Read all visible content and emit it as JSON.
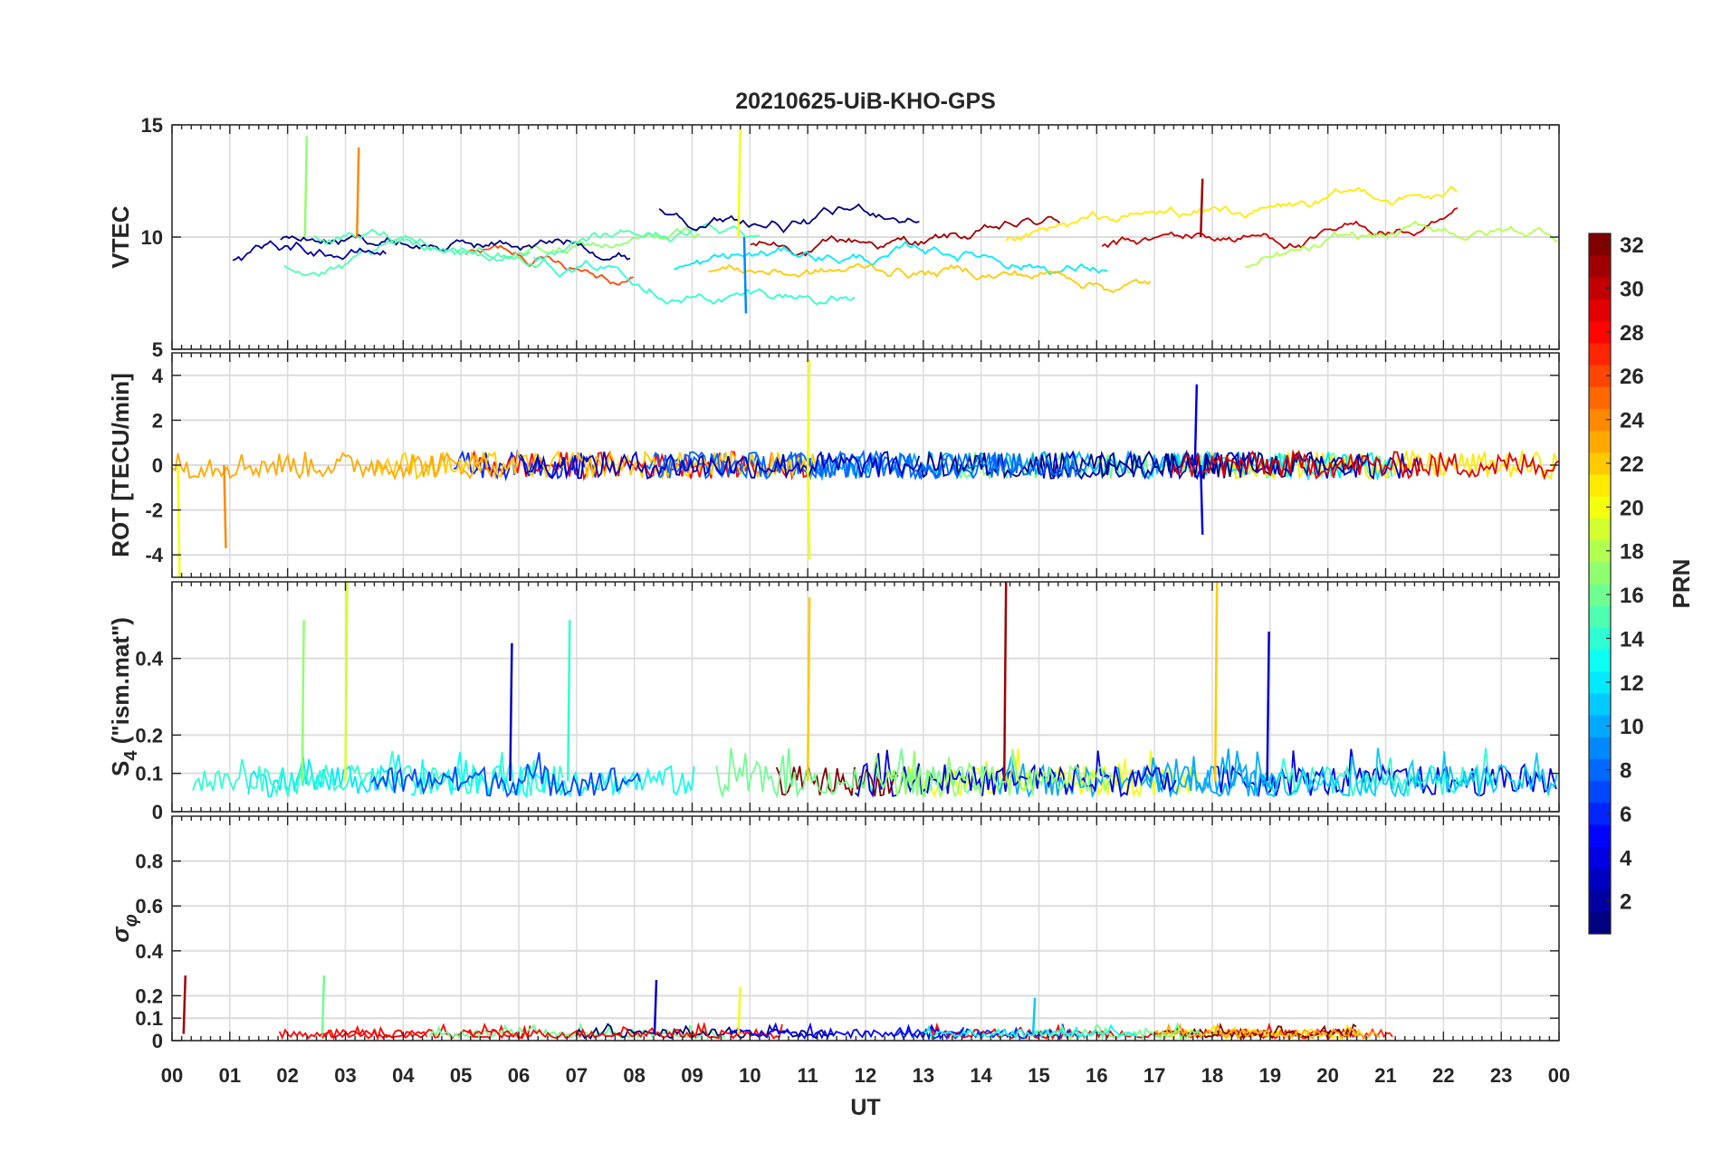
{
  "chart_data": {
    "type": "line",
    "title": "20210625-UiB-KHO-GPS",
    "xlabel": "UT",
    "x_ticks": [
      "00",
      "01",
      "02",
      "03",
      "04",
      "05",
      "06",
      "07",
      "08",
      "09",
      "10",
      "11",
      "12",
      "13",
      "14",
      "15",
      "16",
      "17",
      "18",
      "19",
      "20",
      "21",
      "22",
      "23",
      "00"
    ],
    "xlim": [
      0,
      24
    ],
    "grid": true,
    "colormap": "jet",
    "colorbar": {
      "label": "PRN",
      "range": [
        1,
        32
      ],
      "ticks": [
        "2",
        "4",
        "6",
        "8",
        "10",
        "12",
        "14",
        "16",
        "18",
        "20",
        "22",
        "24",
        "26",
        "28",
        "30",
        "32"
      ],
      "placement": "right"
    },
    "panels": [
      {
        "ylabel": "VTEC",
        "ylim": [
          5,
          15
        ],
        "yticks": [
          "5",
          "10",
          "15"
        ],
        "typical_range": [
          7,
          13
        ],
        "peak_events": [
          {
            "ut": 2.3,
            "value": 14.5,
            "prn": 17
          },
          {
            "ut": 3.2,
            "value": 14.0,
            "prn": 24
          },
          {
            "ut": 9.8,
            "value": 14.8,
            "prn": 20
          },
          {
            "ut": 9.9,
            "value": 6.6,
            "prn": 9
          },
          {
            "ut": 17.8,
            "value": 12.6,
            "prn": 31
          }
        ]
      },
      {
        "ylabel": "ROT [TECU/min]",
        "ylim": [
          -5,
          5
        ],
        "yticks": [
          "-4",
          "-2",
          "0",
          "2",
          "4"
        ],
        "typical_range": [
          -0.6,
          0.6
        ],
        "peak_events": [
          {
            "ut": 0.1,
            "value": -5.0,
            "prn": 20
          },
          {
            "ut": 0.9,
            "value": -3.7,
            "prn": 24
          },
          {
            "ut": 11.0,
            "value": 4.7,
            "prn": 20
          },
          {
            "ut": 11.0,
            "value": -4.2,
            "prn": 20
          },
          {
            "ut": 17.7,
            "value": 3.6,
            "prn": 4
          },
          {
            "ut": 17.8,
            "value": -3.1,
            "prn": 4
          }
        ]
      },
      {
        "ylabel": "S4 (\"ism.mat\")",
        "ylim": [
          0,
          0.6
        ],
        "yticks": [
          "0",
          "0.1",
          "0.2",
          "0.4"
        ],
        "typical_range": [
          0.04,
          0.12
        ],
        "peak_events": [
          {
            "ut": 2.25,
            "value": 0.5,
            "prn": 17
          },
          {
            "ut": 3.0,
            "value": 0.6,
            "prn": 19
          },
          {
            "ut": 5.85,
            "value": 0.44,
            "prn": 3
          },
          {
            "ut": 6.85,
            "value": 0.5,
            "prn": 14
          },
          {
            "ut": 11.0,
            "value": 0.56,
            "prn": 22
          },
          {
            "ut": 14.4,
            "value": 0.6,
            "prn": 31
          },
          {
            "ut": 18.05,
            "value": 0.6,
            "prn": 22
          },
          {
            "ut": 18.95,
            "value": 0.47,
            "prn": 3
          }
        ]
      },
      {
        "ylabel": "σφ",
        "ylim": [
          0,
          1
        ],
        "yticks": [
          "0",
          "0.1",
          "0.2",
          "0.4",
          "0.6",
          "0.8"
        ],
        "typical_range": [
          0.01,
          0.05
        ],
        "peak_events": [
          {
            "ut": 0.2,
            "value": 0.29,
            "prn": 31
          },
          {
            "ut": 2.6,
            "value": 0.29,
            "prn": 16
          },
          {
            "ut": 8.35,
            "value": 0.27,
            "prn": 3
          },
          {
            "ut": 9.8,
            "value": 0.24,
            "prn": 20
          },
          {
            "ut": 14.9,
            "value": 0.19,
            "prn": 11
          }
        ]
      }
    ]
  }
}
